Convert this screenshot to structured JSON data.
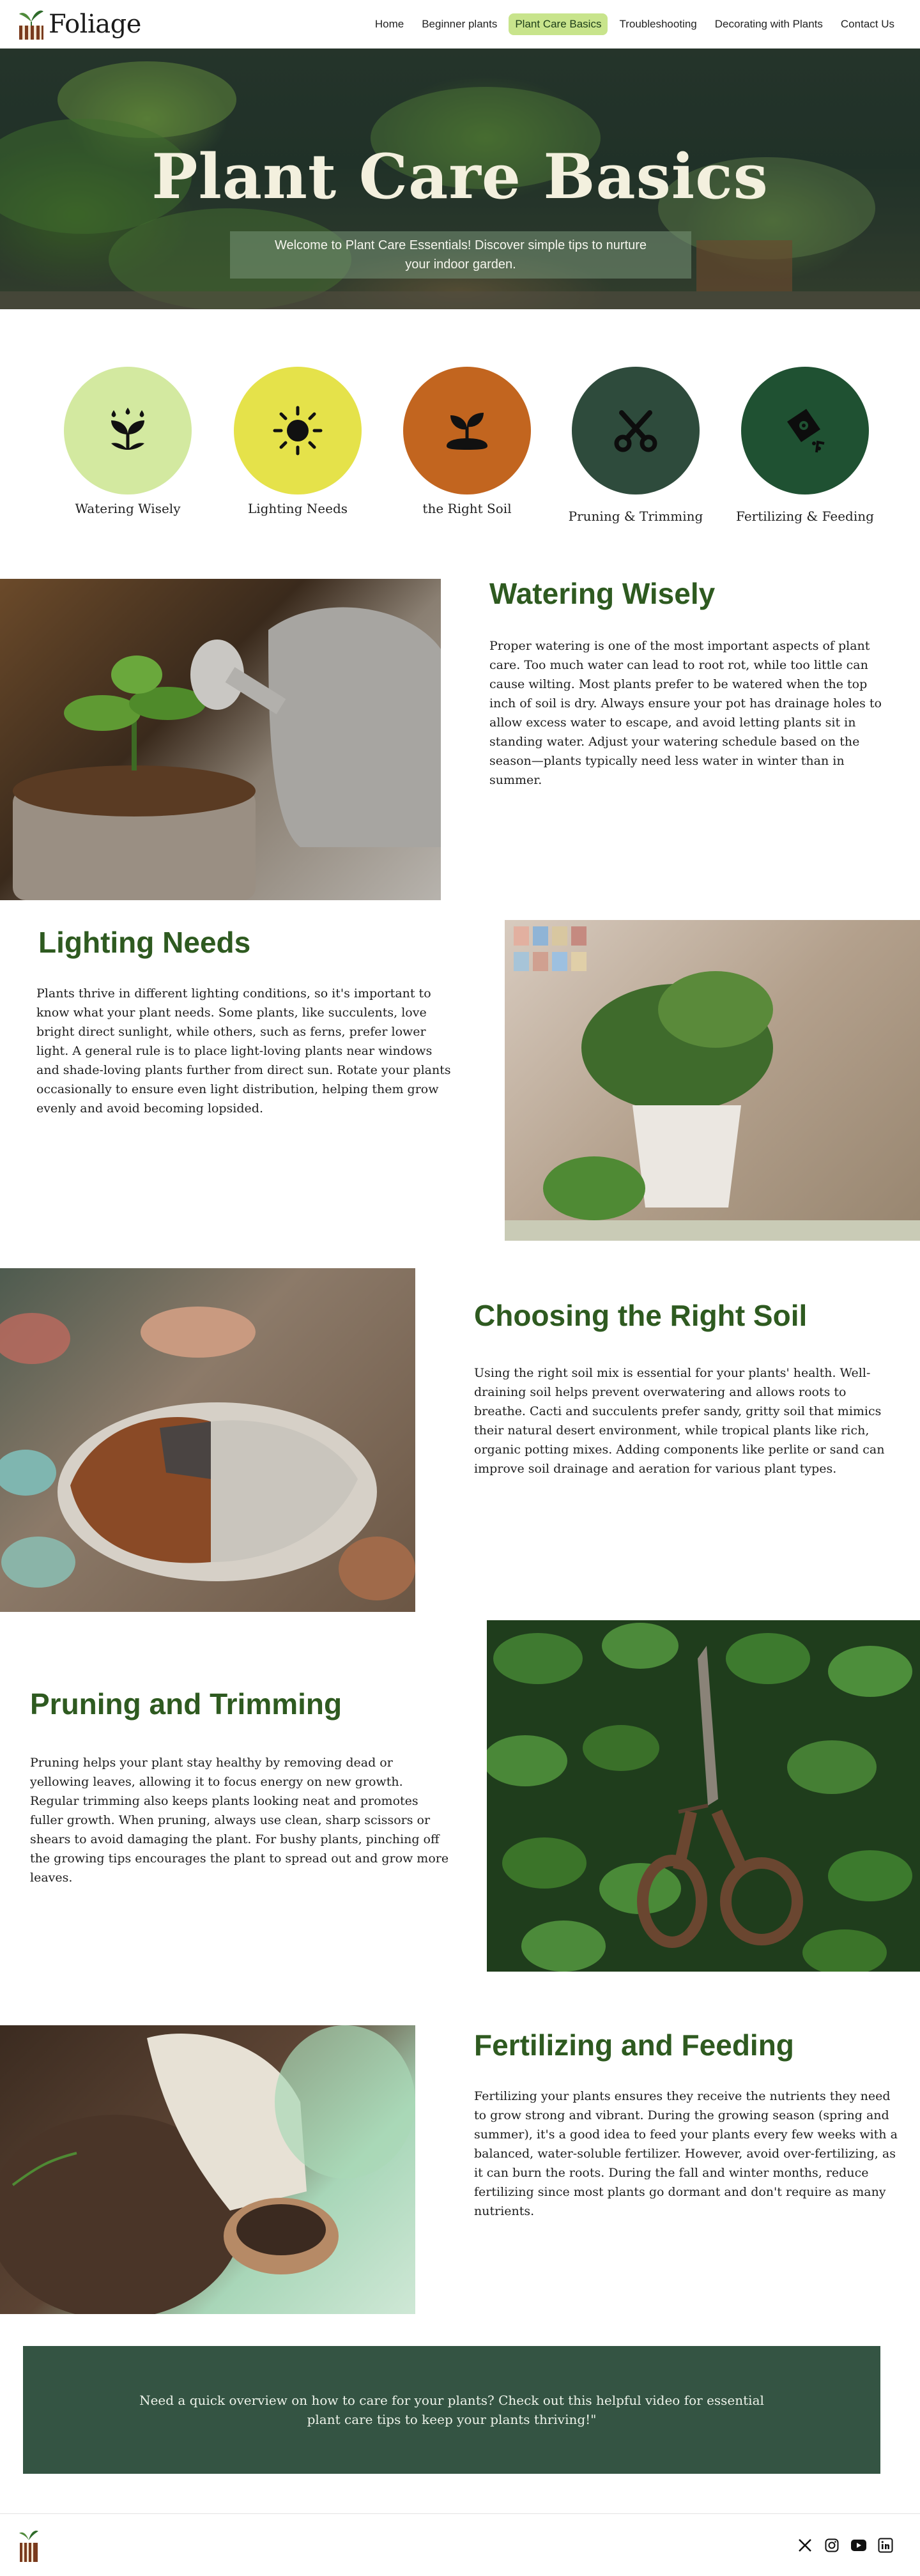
{
  "brand": {
    "name": "Foliage"
  },
  "nav": {
    "items": [
      {
        "label": "Home",
        "active": false
      },
      {
        "label": "Beginner plants",
        "active": false
      },
      {
        "label": "Plant Care Basics",
        "active": true
      },
      {
        "label": "Troubleshooting",
        "active": false
      },
      {
        "label": "Decorating with Plants",
        "active": false
      },
      {
        "label": "Contact Us",
        "active": false
      }
    ]
  },
  "hero": {
    "title": "Plant Care Basics",
    "subtitle": "Welcome to Plant Care Essentials! Discover simple tips to nurture your indoor garden."
  },
  "topics": [
    {
      "label": "Watering Wisely",
      "icon": "watering-plant-icon",
      "color": "#d3e9a0"
    },
    {
      "label": "Lighting Needs",
      "icon": "sun-icon",
      "color": "#e5e24a"
    },
    {
      "label": "the Right Soil",
      "icon": "soil-sprout-icon",
      "color": "#c2651f"
    },
    {
      "label": "Pruning & Trimming",
      "icon": "scissors-icon",
      "color": "#2e4b3c"
    },
    {
      "label": "Fertilizing & Feeding",
      "icon": "fertilizer-bag-icon",
      "color": "#1f5132"
    }
  ],
  "sections": {
    "watering": {
      "title": "Watering Wisely",
      "text": "Proper watering is one of the most important aspects of plant care. Too much water can lead to root rot, while too little can cause wilting. Most plants prefer to be watered when the top inch of soil is dry. Always ensure your pot has drainage holes to allow excess water to escape, and avoid letting plants sit in standing water. Adjust your watering schedule based on the season—plants typically need less water in winter than in summer."
    },
    "lighting": {
      "title": "Lighting Needs",
      "text": "Plants thrive in different lighting conditions, so it's important to know what your plant needs. Some plants, like succulents, love bright direct sunlight, while others, such as ferns, prefer lower light. A general rule is to place light-loving plants near windows and shade-loving plants further from direct sun. Rotate your plants occasionally to ensure even light distribution, helping them grow evenly and avoid becoming lopsided."
    },
    "soil": {
      "title": "Choosing the Right Soil",
      "text": "Using the right soil mix is essential for your plants' health. Well-draining soil helps prevent overwatering and allows roots to breathe. Cacti and succulents prefer sandy, gritty soil that mimics their natural desert environment, while tropical plants like rich, organic potting mixes. Adding components like perlite or sand can improve soil drainage and aeration for various plant types."
    },
    "pruning": {
      "title": "Pruning and Trimming",
      "text": "Pruning helps your plant stay healthy by removing dead or yellowing leaves, allowing it to focus energy on new growth. Regular trimming also keeps plants looking neat and promotes fuller growth. When pruning, always use clean, sharp scissors or shears to avoid damaging the plant. For bushy plants, pinching off the growing tips encourages the plant to spread out and grow more leaves."
    },
    "fertilizing": {
      "title": "Fertilizing and Feeding",
      "text": "Fertilizing your plants ensures they receive the nutrients they need to grow strong and vibrant. During the growing season (spring and summer), it's a good idea to feed your plants every few weeks with a balanced, water-soluble fertilizer. However, avoid over-fertilizing, as it can burn the roots. During the fall and winter months, reduce fertilizing since most plants go dormant and don't require as many nutrients."
    }
  },
  "cta": {
    "text": "Need a quick overview on how to care for your plants? Check out this helpful video for essential plant care tips to keep your plants thriving!\""
  },
  "footer": {
    "socials": [
      "x-icon",
      "instagram-icon",
      "youtube-icon",
      "linkedin-icon"
    ]
  }
}
